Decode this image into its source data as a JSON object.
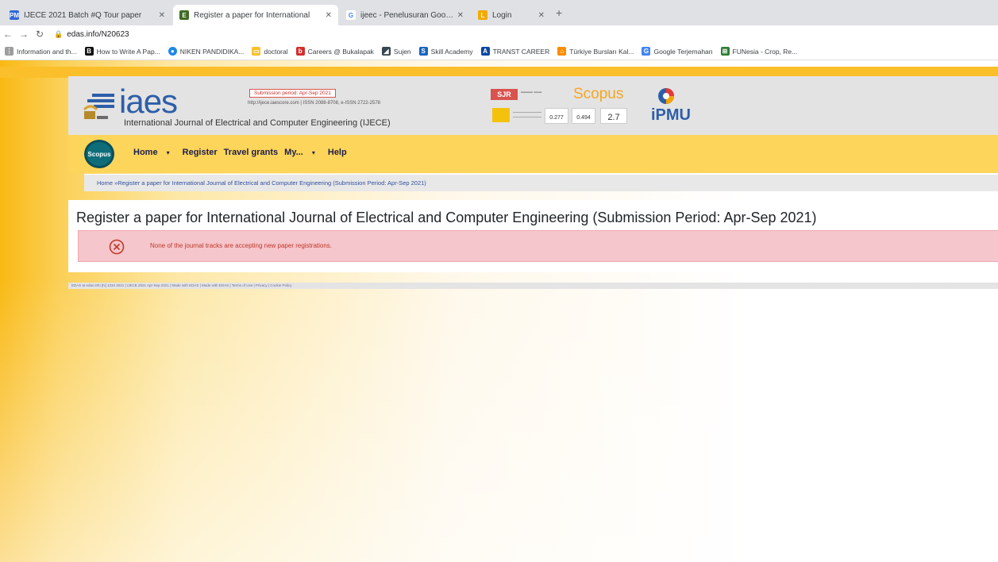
{
  "browser": {
    "tabs": [
      {
        "title": "IJECE 2021 Batch #Q Tour paper",
        "favicon": "pm-icon"
      },
      {
        "title": "Register a paper for International",
        "favicon": "edas-icon",
        "active": true
      },
      {
        "title": "ijeec - Penelusuran Google",
        "favicon": "google-icon"
      },
      {
        "title": "Login",
        "favicon": "login-icon"
      }
    ],
    "new_tab": "+",
    "url": "edas.info/N20623",
    "bookmarks": [
      "Information and th...",
      "How to Write A Pap...",
      "NIKEN PANDIDIKA...",
      "doctoral",
      "Careers @ Bukalapak",
      "Sujen",
      "Skill Academy",
      "TRANST CAREER",
      "Türkiye Bursları Kal...",
      "Google Terjemahan",
      "FUNesia - Crop, Re..."
    ]
  },
  "header": {
    "logo": "iaes",
    "journal_name": "International Journal of Electrical and Computer Engineering (IJECE)",
    "period_badge": "Submission period: Apr-Sep 2021",
    "issn": "http://ijece.iaescore.com | ISSN 2088-8708, e-ISSN 2722-2578",
    "sjr": "SJR",
    "scopus": "Scopus",
    "metrics": [
      "0.277",
      "0.494",
      "2.7"
    ],
    "ipmu": "iPMU"
  },
  "nav": {
    "scopus_badge": "Scopus",
    "home": "Home",
    "register": "Register",
    "travel_grants": "Travel grants",
    "my": "My...",
    "help": "Help"
  },
  "breadcrumb": "Home »Register a paper for International Journal of Electrical and Computer Engineering (Submission Period: Apr-Sep 2021)",
  "main": {
    "title": "Register a paper for International Journal of Electrical and Computer Engineering (Submission Period: Apr-Sep 2021)",
    "alert": "None of the journal tracks are accepting new paper registrations."
  },
  "footer": "EDAS at edas.info [N] 1234 2021 | IJECE 2021 Apr-Sep 2021 | Made with EDAS | Made with EDAS | Terms of Use | Privacy | Cookie Policy"
}
